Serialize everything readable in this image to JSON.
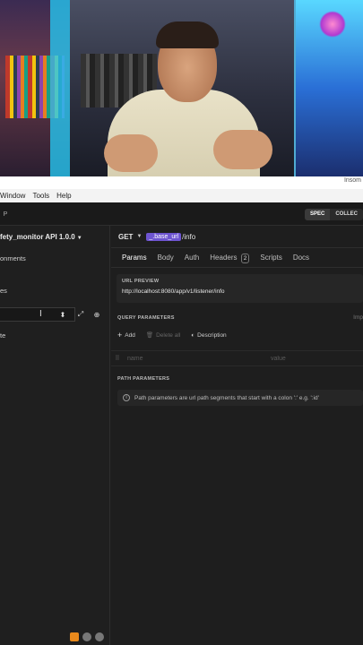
{
  "window": {
    "app_title": "Insom"
  },
  "menubar": {
    "items": [
      "Window",
      "Tools",
      "Help"
    ]
  },
  "header": {
    "left_badge": "P",
    "segments": [
      "SPEC",
      "COLLEC"
    ]
  },
  "sidebar": {
    "doc_title": "fety_monitor API 1.0.0",
    "items": [
      "onments",
      "es",
      "te"
    ]
  },
  "request": {
    "method": "GET",
    "env_var": "_.base_url",
    "path": "/info"
  },
  "tabs": [
    {
      "label": "Params",
      "active": true
    },
    {
      "label": "Body"
    },
    {
      "label": "Auth"
    },
    {
      "label": "Headers",
      "count": "2"
    },
    {
      "label": "Scripts"
    },
    {
      "label": "Docs"
    }
  ],
  "url_preview": {
    "label": "URL PREVIEW",
    "value": "http://localhost:8080/app/v1/listener/info"
  },
  "query_params": {
    "label": "QUERY PARAMETERS",
    "right_label": "Imp",
    "add": "Add",
    "delete_all": "Delete all",
    "description": "Description",
    "name_placeholder": "name",
    "value_placeholder": "value"
  },
  "path_params": {
    "label": "PATH PARAMETERS",
    "info": "Path parameters are url path segments that start with a colon ':' e.g. ':id'"
  },
  "colors": {
    "accent": "#6e55d1",
    "background": "#1e1e1e",
    "sidebar": "#1f1f1f"
  }
}
